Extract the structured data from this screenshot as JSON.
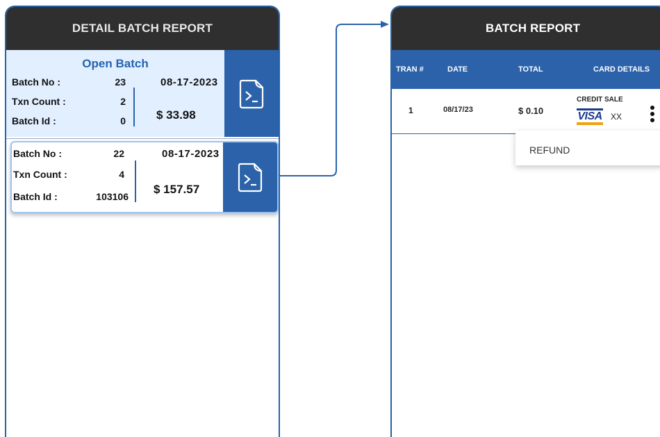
{
  "left_screen": {
    "title": "DETAIL BATCH REPORT",
    "open_batch": {
      "heading": "Open Batch",
      "batch_no_label": "Batch No :",
      "batch_no": "23",
      "txn_count_label": "Txn Count :",
      "txn_count": "2",
      "batch_id_label": "Batch Id :",
      "batch_id": "0",
      "date": "08-17-2023",
      "amount": "$ 33.98"
    },
    "closed_batch": {
      "batch_no_label": "Batch No :",
      "batch_no": "22",
      "txn_count_label": "Txn Count :",
      "txn_count": "4",
      "batch_id_label": "Batch Id :",
      "batch_id": "103106",
      "date": "08-17-2023",
      "amount": "$ 157.57"
    },
    "action_icon": "terminal-document-icon"
  },
  "right_screen": {
    "title": "BATCH REPORT",
    "columns": [
      "TRAN #",
      "DATE",
      "TOTAL",
      "CARD DETAILS"
    ],
    "rows": [
      {
        "tran": "1",
        "date": "08/17/23",
        "total": "$ 0.10",
        "sale_type": "CREDIT SALE",
        "card_brand": "VISA",
        "card_last": "XX"
      }
    ],
    "menu": {
      "refund": "REFUND"
    }
  },
  "colors": {
    "header_dark": "#2f2f2f",
    "accent_blue": "#2b62aa",
    "open_batch_bg": "#e2efff"
  }
}
